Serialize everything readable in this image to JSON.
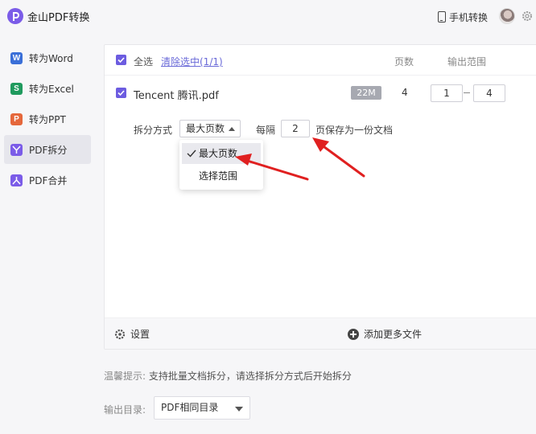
{
  "app": {
    "title": "金山PDF转换",
    "phone_label": "手机转换"
  },
  "sidebar": {
    "items": [
      {
        "label": "转为Word",
        "icon": "W",
        "color": "#3a6fd8"
      },
      {
        "label": "转为Excel",
        "icon": "S",
        "color": "#1f9a5e"
      },
      {
        "label": "转为PPT",
        "icon": "P",
        "color": "#e5673b"
      },
      {
        "label": "PDF拆分",
        "icon": "split-icon",
        "color": "#7b5ce8",
        "active": true
      },
      {
        "label": "PDF合并",
        "icon": "merge-icon",
        "color": "#7b5ce8"
      }
    ]
  },
  "file_list": {
    "select_all_label": "全选",
    "clear_label": "清除选中(1/1)",
    "col_pages": "页数",
    "col_range": "输出范围",
    "file": {
      "name": "Tencent 腾讯.pdf",
      "size": "22M",
      "pages": "4",
      "range_from": "1",
      "range_to": "4"
    }
  },
  "split": {
    "method_label": "拆分方式",
    "method_value": "最大页数",
    "every_label": "每隔",
    "every_value": "2",
    "every_suffix": "页保存为一份文档",
    "options": [
      "最大页数",
      "选择范围"
    ]
  },
  "footer": {
    "settings_label": "设置",
    "add_more_label": "添加更多文件"
  },
  "tip": {
    "label": "温馨提示:",
    "text": "支持批量文档拆分，请选择拆分方式后开始拆分"
  },
  "output": {
    "label": "输出目录:",
    "value": "PDF相同目录"
  },
  "colors": {
    "accent": "#6c5ce0",
    "annotation_arrow": "#e02020"
  }
}
